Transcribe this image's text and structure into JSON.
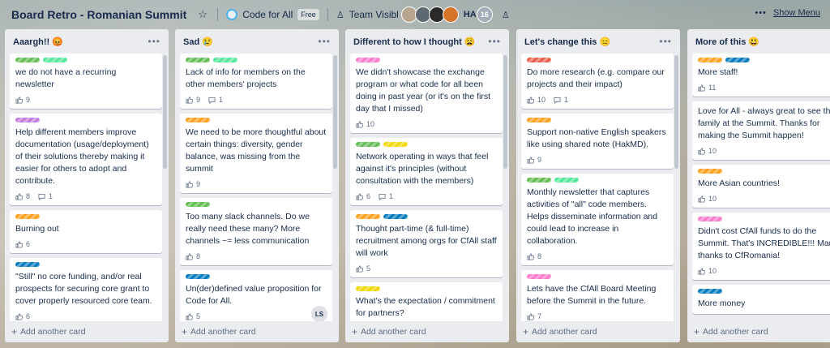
{
  "board": {
    "title": "Board Retro - Romanian Summit",
    "team": "Code for All",
    "team_badge": "Free",
    "visibility": "Team Visibl",
    "member_initials": "HA",
    "member_count": "16",
    "show_menu": "Show Menu"
  },
  "colors": {
    "green": "#61bd4f",
    "teal": "#51e898",
    "pink": "#ff78cb",
    "purple": "#c377e0",
    "orange": "#ff9f1a",
    "blue": "#0079bf",
    "yellow": "#f2d600",
    "red": "#eb5a46"
  },
  "add_card_label": "Add another card",
  "lists": [
    {
      "title": "Aaargh!! 😡",
      "cards": [
        {
          "labels": [
            "green",
            "teal"
          ],
          "text": "we do not have a recurring newsletter",
          "likes": "9",
          "comments": ""
        },
        {
          "labels": [
            "purple"
          ],
          "text": "Help different members improve documentation (usage/deployment) of their solutions thereby making it easier for others to adopt and contribute.",
          "likes": "8",
          "comments": "1"
        },
        {
          "labels": [
            "orange"
          ],
          "text": "Burning out",
          "likes": "6",
          "comments": ""
        },
        {
          "labels": [
            "blue"
          ],
          "text": "\"Still\" no core funding, and/or real prospects for securing core grant to cover properly resourced core team.",
          "likes": "6",
          "comments": ""
        }
      ]
    },
    {
      "title": "Sad 😢",
      "cards": [
        {
          "labels": [
            "green",
            "teal"
          ],
          "text": "Lack of info for members on the other members' projects",
          "likes": "9",
          "comments": "1"
        },
        {
          "labels": [
            "orange"
          ],
          "text": "We need to be more thoughtful about certain things: diversity, gender balance, was missing from the summit",
          "likes": "9",
          "comments": ""
        },
        {
          "labels": [
            "green"
          ],
          "text": "Too many slack channels. Do we really need these many? More channels ~= less communication",
          "likes": "8",
          "comments": ""
        },
        {
          "labels": [
            "blue"
          ],
          "text": "Un(der)defined value proposition for Code for All.",
          "likes": "5",
          "comments": "",
          "member": "LS"
        }
      ]
    },
    {
      "title": "Different to how I thought 😩",
      "cards": [
        {
          "labels": [
            "pink"
          ],
          "text": "We didn't showcase the exchange program or what code for all been doing in past year (or it's on the first day that I missed)",
          "likes": "10",
          "comments": ""
        },
        {
          "labels": [
            "green",
            "yellow"
          ],
          "text": "Network operating in ways that feel against it's principles (without consultation with the members)",
          "likes": "6",
          "comments": "1"
        },
        {
          "labels": [
            "orange",
            "blue"
          ],
          "text": "Thought part-time (& full-time) recruitment among orgs for CfAll staff will work",
          "likes": "5",
          "comments": ""
        },
        {
          "labels": [
            "yellow"
          ],
          "text": "What's the expectation / commitment for partners?",
          "likes": "",
          "comments": ""
        }
      ]
    },
    {
      "title": "Let's change this 😑",
      "cards": [
        {
          "labels": [
            "red"
          ],
          "text": "Do more research (e.g. compare our projects and their impact)",
          "likes": "10",
          "comments": "1"
        },
        {
          "labels": [
            "orange"
          ],
          "text": "Support non-native English speakers like using shared note (HakMD).",
          "likes": "9",
          "comments": ""
        },
        {
          "labels": [
            "green",
            "teal"
          ],
          "text": "Monthly newsletter that captures activities of \"all\" code members. Helps disseminate information and could lead to increase in collaboration.",
          "likes": "8",
          "comments": ""
        },
        {
          "labels": [
            "pink"
          ],
          "text": "Lets have the CfAll Board Meeting before the Summit in the future.",
          "likes": "7",
          "comments": ""
        }
      ]
    },
    {
      "title": "More of this 😃",
      "cards": [
        {
          "labels": [
            "orange",
            "blue"
          ],
          "text": "More staff!",
          "likes": "11",
          "comments": ""
        },
        {
          "labels": [],
          "text": "Love for All - always great to see the family at the Summit. Thanks for making the Summit happen!",
          "likes": "10",
          "comments": ""
        },
        {
          "labels": [
            "orange"
          ],
          "text": "More Asian countries!",
          "likes": "10",
          "comments": ""
        },
        {
          "labels": [
            "pink"
          ],
          "text": "Didn't cost CfAll funds to do the Summit. That's INCREDIBLE!!! Many thanks to CfRomania!",
          "likes": "10",
          "comments": ""
        },
        {
          "labels": [
            "blue"
          ],
          "text": "More money",
          "likes": "",
          "comments": ""
        }
      ]
    }
  ]
}
